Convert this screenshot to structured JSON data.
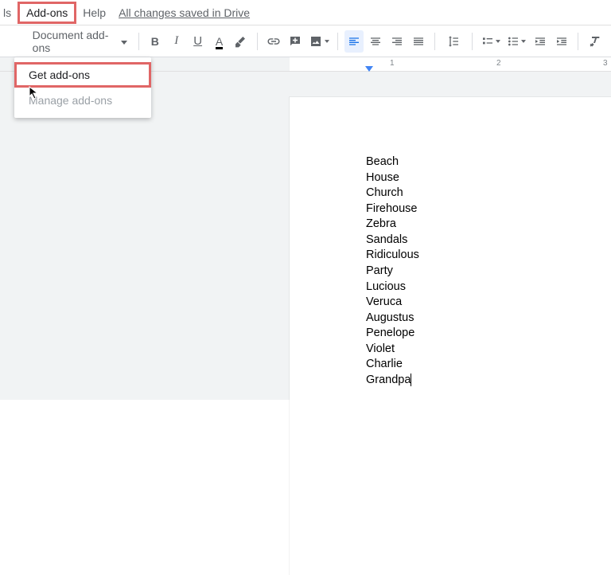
{
  "menubar": {
    "truncated_item": "ls",
    "addons": "Add-ons",
    "help": "Help",
    "save_status": "All changes saved in Drive"
  },
  "toolbar": {
    "style_label": "Document add-ons"
  },
  "dropdown": {
    "get_addons": "Get add-ons",
    "manage_addons": "Manage add-ons"
  },
  "ruler": {
    "n1": "1",
    "n2": "2",
    "n3": "3"
  },
  "document": {
    "lines": [
      "Beach",
      "House",
      "Church",
      "Firehouse",
      "Zebra",
      "Sandals",
      "Ridiculous",
      "Party",
      "Lucious",
      "Veruca",
      "Augustus",
      "Penelope",
      "Violet",
      "Charlie",
      "Grandpa"
    ]
  }
}
